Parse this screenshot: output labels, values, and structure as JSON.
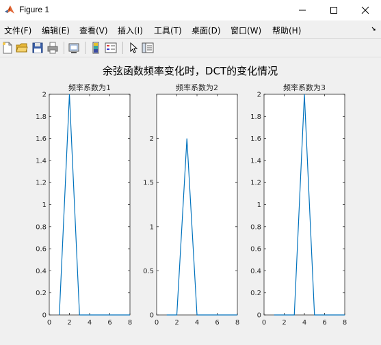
{
  "window": {
    "title": "Figure 1",
    "icon": "matlab-logo-icon",
    "controls": {
      "minimize": "minimize-icon",
      "maximize": "maximize-icon",
      "close": "close-icon"
    }
  },
  "menubar": {
    "items": [
      {
        "label": "文件(F)"
      },
      {
        "label": "编辑(E)"
      },
      {
        "label": "查看(V)"
      },
      {
        "label": "插入(I)"
      },
      {
        "label": "工具(T)"
      },
      {
        "label": "桌面(D)"
      },
      {
        "label": "窗口(W)"
      },
      {
        "label": "帮助(H)"
      }
    ],
    "overflow_icon": "dock-arrow-icon"
  },
  "toolbar": {
    "buttons": [
      {
        "icon": "new-figure-icon"
      },
      {
        "icon": "open-file-icon"
      },
      {
        "icon": "save-icon"
      },
      {
        "icon": "print-icon"
      },
      {
        "icon": "link-plot-icon"
      },
      {
        "icon": "insert-colorbar-icon"
      },
      {
        "icon": "insert-legend-icon"
      },
      {
        "icon": "edit-plot-icon"
      },
      {
        "icon": "property-inspector-icon"
      }
    ]
  },
  "figure": {
    "suptitle": "余弦函数频率变化时，DCT的变化情况",
    "colors": {
      "line": "#0072bd",
      "background": "#f0f0f0",
      "axes_bg": "#ffffff"
    }
  },
  "chart_data": [
    {
      "type": "line",
      "title": "频率系数为1",
      "x": [
        1,
        2,
        3,
        4,
        5,
        6,
        7,
        8
      ],
      "series": [
        {
          "values": [
            0,
            2,
            0,
            0,
            0,
            0,
            0,
            0
          ]
        }
      ],
      "xlim": [
        0,
        8
      ],
      "ylim": [
        0,
        2
      ],
      "xticks": [
        "0",
        "2",
        "4",
        "6",
        "8"
      ],
      "yticks": [
        "0",
        "0.2",
        "0.4",
        "0.6",
        "0.8",
        "1",
        "1.2",
        "1.4",
        "1.6",
        "1.8",
        "2"
      ],
      "ytick_values": [
        0,
        0.2,
        0.4,
        0.6,
        0.8,
        1,
        1.2,
        1.4,
        1.6,
        1.8,
        2
      ],
      "grid": false
    },
    {
      "type": "line",
      "title": "频率系数为2",
      "x": [
        1,
        2,
        3,
        4,
        5,
        6,
        7,
        8
      ],
      "series": [
        {
          "values": [
            0,
            0,
            2,
            0,
            0,
            0,
            0,
            0
          ]
        }
      ],
      "xlim": [
        0,
        8
      ],
      "ylim": [
        0,
        2.5
      ],
      "xticks": [
        "0",
        "2",
        "4",
        "6",
        "8"
      ],
      "yticks": [
        "0",
        "0.5",
        "1",
        "1.5",
        "2"
      ],
      "ytick_values": [
        0,
        0.5,
        1,
        1.5,
        2
      ],
      "grid": false
    },
    {
      "type": "line",
      "title": "频率系数为3",
      "x": [
        1,
        2,
        3,
        4,
        5,
        6,
        7,
        8
      ],
      "series": [
        {
          "values": [
            0,
            0,
            0,
            2,
            0,
            0,
            0,
            0
          ]
        }
      ],
      "xlim": [
        0,
        8
      ],
      "ylim": [
        0,
        2
      ],
      "xticks": [
        "0",
        "2",
        "4",
        "6",
        "8"
      ],
      "yticks": [
        "0",
        "0.2",
        "0.4",
        "0.6",
        "0.8",
        "1",
        "1.2",
        "1.4",
        "1.6",
        "1.8",
        "2"
      ],
      "ytick_values": [
        0,
        0.2,
        0.4,
        0.6,
        0.8,
        1,
        1.2,
        1.4,
        1.6,
        1.8,
        2
      ],
      "grid": false
    }
  ]
}
